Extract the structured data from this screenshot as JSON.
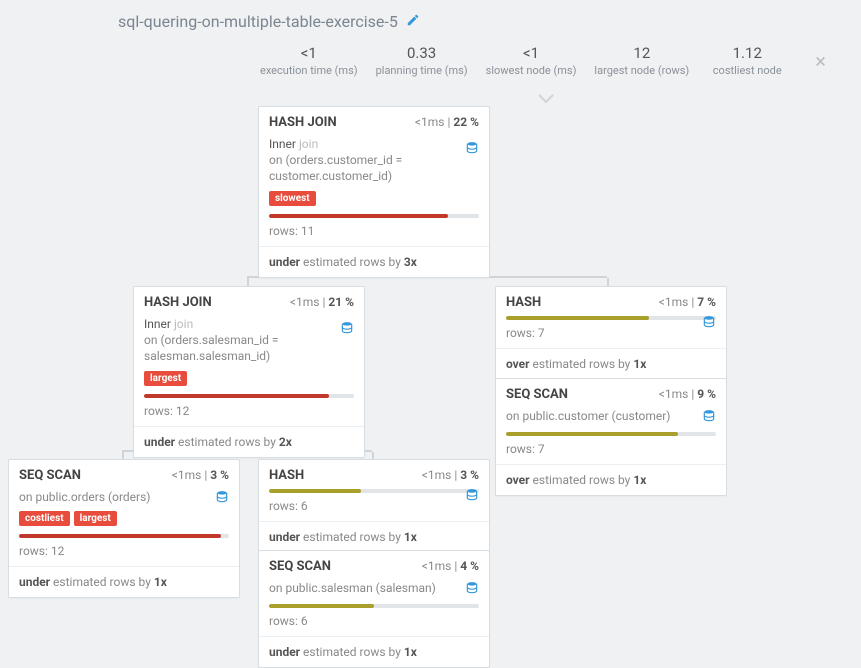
{
  "title": "sql-quering-on-multiple-table-exercise-5",
  "stats": {
    "exec_val": "<1",
    "exec_lbl": "execution time (ms)",
    "plan_val": "0.33",
    "plan_lbl": "planning time (ms)",
    "slow_val": "<1",
    "slow_lbl": "slowest node (ms)",
    "large_val": "12",
    "large_lbl": "largest node (rows)",
    "cost_val": "1.12",
    "cost_lbl": "costliest node"
  },
  "labels": {
    "rows_prefix": "rows: ",
    "inner": "Inner ",
    "join": "join",
    "on_prefix": "on ",
    "under": "under",
    "over": "over",
    "est_rows_by": " estimated rows by ",
    "badge_slowest": "slowest",
    "badge_largest": "largest",
    "badge_costliest": "costliest"
  },
  "nodes": {
    "n1": {
      "title": "HASH JOIN",
      "time": "<1ms",
      "pct": "22 %",
      "cond": "(orders.customer_id = customer.customer_id)",
      "rows": "11",
      "est_dir": "under",
      "est_x": "3x",
      "bar_color": "red",
      "bar_pct": 85
    },
    "n2": {
      "title": "HASH JOIN",
      "time": "<1ms",
      "pct": "21 %",
      "cond": "(orders.salesman_id = salesman.salesman_id)",
      "rows": "12",
      "est_dir": "under",
      "est_x": "2x",
      "bar_color": "red",
      "bar_pct": 88
    },
    "n3": {
      "title": "HASH",
      "time": "<1ms",
      "pct": "7 %",
      "rows": "7",
      "est_dir": "over",
      "est_x": "1x",
      "bar_color": "olive",
      "bar_pct": 68
    },
    "n4": {
      "title": "SEQ SCAN",
      "time": "<1ms",
      "pct": "9 %",
      "target": "public.customer (customer)",
      "rows": "7",
      "est_dir": "over",
      "est_x": "1x",
      "bar_color": "olive",
      "bar_pct": 82
    },
    "n5": {
      "title": "SEQ SCAN",
      "time": "<1ms",
      "pct": "3 %",
      "target": "public.orders (orders)",
      "rows": "12",
      "est_dir": "under",
      "est_x": "1x",
      "bar_color": "red",
      "bar_pct": 96
    },
    "n6": {
      "title": "HASH",
      "time": "<1ms",
      "pct": "3 %",
      "rows": "6",
      "est_dir": "under",
      "est_x": "1x",
      "bar_color": "olive",
      "bar_pct": 44
    },
    "n7": {
      "title": "SEQ SCAN",
      "time": "<1ms",
      "pct": "4 %",
      "target": "public.salesman (salesman)",
      "rows": "6",
      "est_dir": "under",
      "est_x": "1x",
      "bar_color": "olive",
      "bar_pct": 50
    }
  }
}
